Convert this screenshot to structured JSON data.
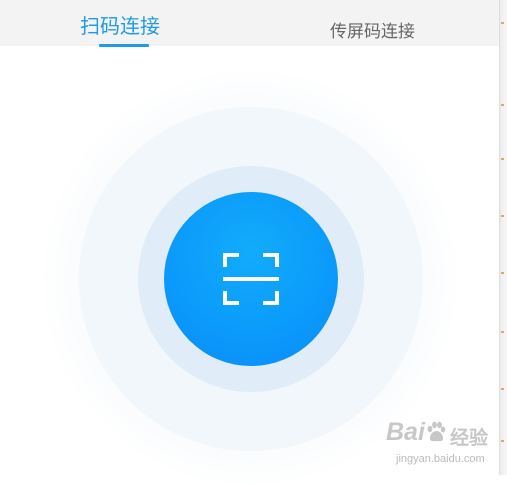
{
  "tabs": [
    {
      "label": "扫码连接",
      "active": true
    },
    {
      "label": "传屏码连接",
      "active": false
    }
  ],
  "scan_button": {
    "icon": "scan-icon"
  },
  "colors": {
    "accent": "#1d9be8",
    "button": "#0b9bfb",
    "tab_bar_bg": "#f3f3f3",
    "inactive_tab_text": "#666666",
    "ring_mid": "#e0ecf7",
    "ring_outer": "#f2f7fb"
  },
  "watermark": {
    "logo_latin": "Bai",
    "logo_cn": "经验",
    "domain": "jingyan.baidu.com",
    "icon": "paw-icon"
  }
}
